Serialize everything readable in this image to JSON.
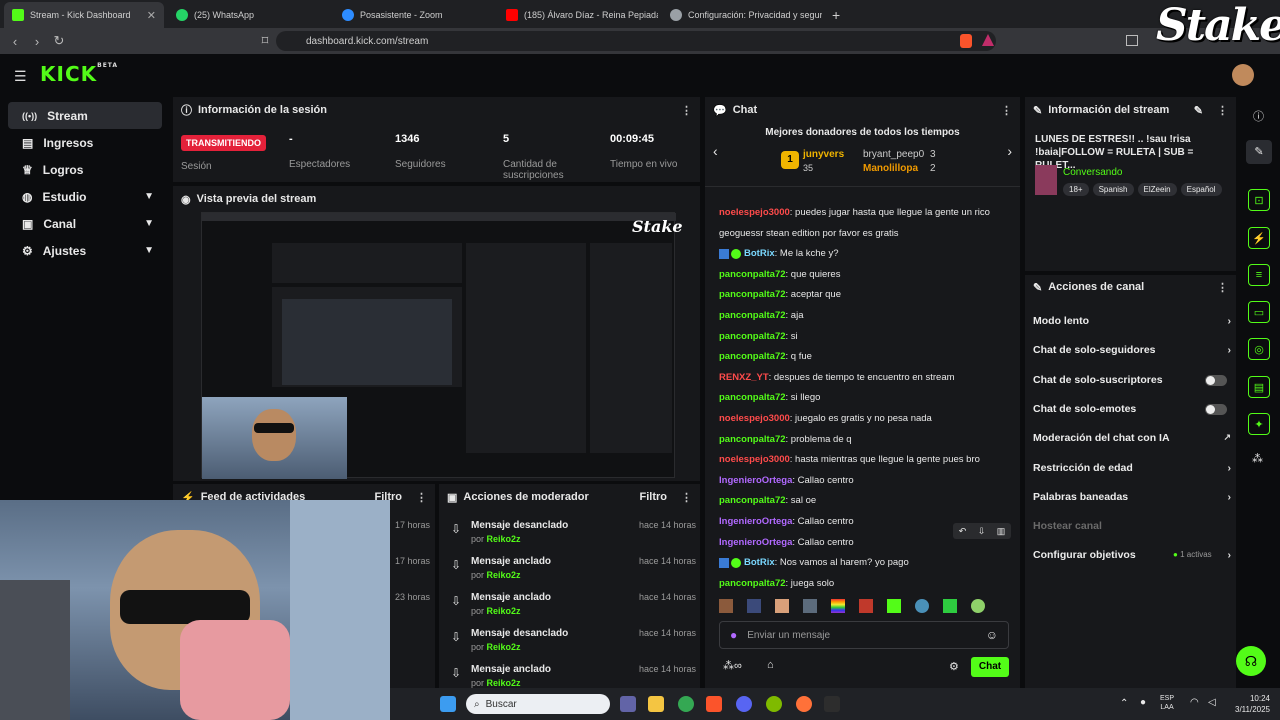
{
  "browser": {
    "tabs": [
      {
        "title": "Stream - Kick Dashboard",
        "color": "#53fc18"
      },
      {
        "title": "(25) WhatsApp",
        "color": "#25d366"
      },
      {
        "title": "Posasistente - Zoom",
        "color": "#2d8cff"
      },
      {
        "title": "(185) Álvaro Díaz - Reina Pepiada (Ly",
        "color": "#ff0000"
      },
      {
        "title": "Configuración: Privacidad y segurida",
        "color": "#9aa0a6"
      }
    ],
    "url": "dashboard.kick.com/stream"
  },
  "overlay": {
    "stake": "Stake"
  },
  "kick": {
    "logo": "KICK",
    "beta": "BETA"
  },
  "sidebar": {
    "items": [
      {
        "label": "Stream",
        "icon": "stream-icon"
      },
      {
        "label": "Ingresos",
        "icon": "money-icon"
      },
      {
        "label": "Logros",
        "icon": "trophy-icon"
      },
      {
        "label": "Estudio",
        "icon": "studio-icon"
      },
      {
        "label": "Canal",
        "icon": "channel-icon"
      },
      {
        "label": "Ajustes",
        "icon": "gear-icon"
      }
    ]
  },
  "session": {
    "title": "Información de la sesión",
    "live_badge": "TRANSMITIENDO",
    "session_label": "Sesión",
    "stats": [
      {
        "value": "-",
        "label": "Espectadores"
      },
      {
        "value": "1346",
        "label": "Seguidores"
      },
      {
        "value": "5",
        "label": "Cantidad de suscripciones"
      },
      {
        "value": "00:09:45",
        "label": "Tiempo en vivo"
      }
    ]
  },
  "preview": {
    "title": "Vista previa del stream"
  },
  "feed": {
    "title": "Feed de actividades",
    "filter": "Filtro",
    "times": [
      "17 horas",
      "17 horas",
      "23 horas"
    ]
  },
  "mod": {
    "title": "Acciones de moderador",
    "filter": "Filtro",
    "items": [
      {
        "action": "Mensaje desanclado",
        "by": "por",
        "user": "Reiko2z",
        "time": "hace 14 horas"
      },
      {
        "action": "Mensaje anclado",
        "by": "por",
        "user": "Reiko2z",
        "time": "hace 14 horas"
      },
      {
        "action": "Mensaje anclado",
        "by": "por",
        "user": "Reiko2z",
        "time": "hace 14 horas"
      },
      {
        "action": "Mensaje desanclado",
        "by": "por",
        "user": "Reiko2z",
        "time": "hace 14 horas"
      },
      {
        "action": "Mensaje anclado",
        "by": "por",
        "user": "Reiko2z",
        "time": "hace 14 horas"
      }
    ]
  },
  "chat": {
    "title": "Chat",
    "donors_title": "Mejores donadores de todos los tiempos",
    "donors": [
      {
        "rank": "1",
        "name": "junyvers",
        "amount": "35"
      },
      {
        "name": "bryant_peep0",
        "amount": "3"
      },
      {
        "name": "Manolillopa",
        "amount": "2"
      }
    ],
    "messages": [
      {
        "user": "noelespejo3000",
        "cls": "ur",
        "text": ": puedes jugar hasta que llegue la gente un rico"
      },
      {
        "user": "",
        "cls": "",
        "text": "geoguessr stean edition por favor es gratis"
      },
      {
        "user": "BotRix",
        "cls": "uk",
        "text": ": Me la kche y?"
      },
      {
        "user": "panconpalta72",
        "cls": "ug",
        "text": ": que quieres"
      },
      {
        "user": "panconpalta72",
        "cls": "ug",
        "text": ": aceptar que"
      },
      {
        "user": "panconpalta72",
        "cls": "ug",
        "text": ": aja"
      },
      {
        "user": "panconpalta72",
        "cls": "ug",
        "text": ": si"
      },
      {
        "user": "panconpalta72",
        "cls": "ug",
        "text": ": q fue"
      },
      {
        "user": "RENXZ_YT",
        "cls": "ur",
        "text": ": despues de tiempo te encuentro en stream"
      },
      {
        "user": "panconpalta72",
        "cls": "ug",
        "text": ": si llego"
      },
      {
        "user": "noelespejo3000",
        "cls": "ur",
        "text": ": juegalo es gratis y no pesa nada"
      },
      {
        "user": "panconpalta72",
        "cls": "ug",
        "text": ": problema de q"
      },
      {
        "user": "noelespejo3000",
        "cls": "ur",
        "text": ": hasta mientras que llegue la gente pues bro"
      },
      {
        "user": "IngenieroOrtega",
        "cls": "up",
        "text": ": Callao centro"
      },
      {
        "user": "panconpalta72",
        "cls": "ug",
        "text": ": sal oe"
      },
      {
        "user": "IngenieroOrtega",
        "cls": "up",
        "text": ": Callao centro"
      },
      {
        "user": "IngenieroOrtega",
        "cls": "up",
        "text": ": Callao centro"
      },
      {
        "user": "BotRix",
        "cls": "uk",
        "text": ": Nos vamos al harem? yo pago"
      },
      {
        "user": "panconpalta72",
        "cls": "ug",
        "text": ": juega solo"
      }
    ],
    "input_placeholder": "Enviar un mensaje",
    "send": "Chat"
  },
  "streaminfo": {
    "title": "Información del stream",
    "stream_title": "LUNES DE ESTRES!! .. !sau !risa !baia|FOLLOW = RULETA | SUB = RULET...",
    "category": "Conversando",
    "tags": [
      "18+",
      "Spanish",
      "ElZeein",
      "Español"
    ]
  },
  "channel": {
    "title": "Acciones de canal",
    "items": [
      {
        "label": "Modo lento",
        "ctrl": "chev"
      },
      {
        "label": "Chat de solo-seguidores",
        "ctrl": "chev"
      },
      {
        "label": "Chat de solo-suscriptores",
        "ctrl": "toggle"
      },
      {
        "label": "Chat de solo-emotes",
        "ctrl": "toggle"
      },
      {
        "label": "Moderación del chat con IA",
        "ctrl": "ext"
      },
      {
        "label": "Restricción de edad",
        "ctrl": "chev"
      },
      {
        "label": "Palabras baneadas",
        "ctrl": "chev"
      },
      {
        "label": "Hostear canal",
        "ctrl": "none"
      },
      {
        "label": "Configurar objetivos",
        "ctrl": "chev",
        "extra": "1 activas"
      }
    ]
  },
  "taskbar": {
    "search": "Buscar",
    "lang1": "ESP",
    "lang2": "LAA",
    "time": "10:24",
    "date": "3/11/2025"
  }
}
